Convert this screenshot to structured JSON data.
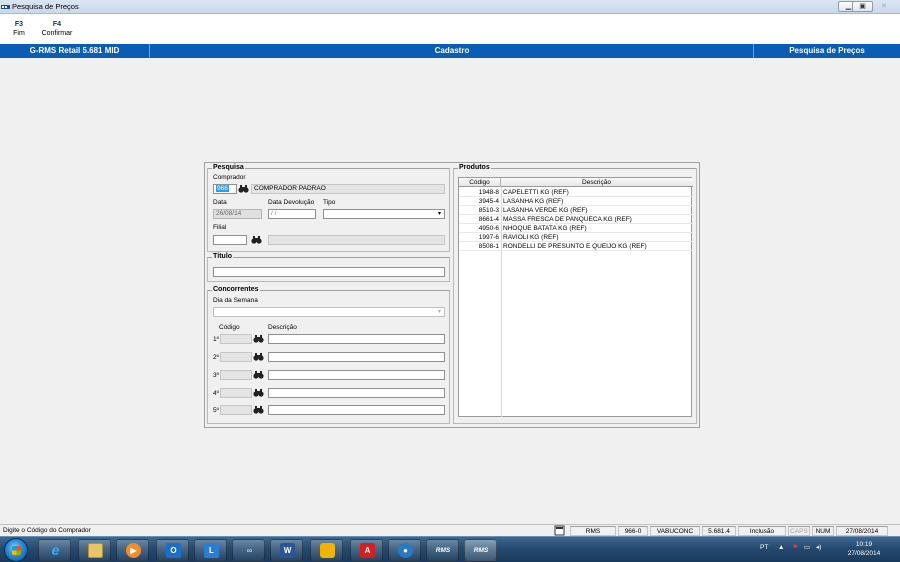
{
  "window": {
    "title": "Pesquisa de Preços"
  },
  "fkeys": [
    {
      "key": "F3",
      "label": "Fim"
    },
    {
      "key": "F4",
      "label": "Confirmar"
    }
  ],
  "header": {
    "version": "G-RMS Retail 5.681 MID",
    "section": "Cadastro",
    "screen": "Pesquisa de Preços"
  },
  "pesquisa": {
    "legend": "Pesquisa",
    "comprador_label": "Comprador",
    "comprador_code": "966",
    "comprador_name": "COMPRADOR PADRAO",
    "data_label": "Data",
    "data_value": "26/08/14",
    "devolucao_label": "Data Devolução",
    "devolucao_value": " / /",
    "tipo_label": "Tipo",
    "tipo_value": "",
    "filial_label": "Filial",
    "filial_value": "",
    "filial_name": ""
  },
  "titulo": {
    "legend": "Título",
    "value": ""
  },
  "concorrentes": {
    "legend": "Concorrentes",
    "dia_label": "Dia da Semana",
    "dia_value": "",
    "col_codigo": "Código",
    "col_descricao": "Descrição",
    "rows": [
      {
        "num": "1º",
        "codigo": "",
        "descricao": ""
      },
      {
        "num": "2º",
        "codigo": "",
        "descricao": ""
      },
      {
        "num": "3º",
        "codigo": "",
        "descricao": ""
      },
      {
        "num": "4º",
        "codigo": "",
        "descricao": ""
      },
      {
        "num": "5º",
        "codigo": "",
        "descricao": ""
      }
    ]
  },
  "produtos": {
    "legend": "Produtos",
    "col_codigo": "Código",
    "col_descricao": "Descrição",
    "rows": [
      {
        "codigo": "1948-8",
        "descricao": "CAPELETTI KG (REF)"
      },
      {
        "codigo": "3945-4",
        "descricao": "LASANHA KG (REF)"
      },
      {
        "codigo": "8510-3",
        "descricao": "LASANHA VERDE KG (REF)"
      },
      {
        "codigo": "8661-4",
        "descricao": "MASSA FRESCA DE PANQUECA KG (REF)"
      },
      {
        "codigo": "4950-6",
        "descricao": "NHOQUE BATATA KG (REF)"
      },
      {
        "codigo": "1997-6",
        "descricao": "RAVIOLI KG (REF)"
      },
      {
        "codigo": "8508-1",
        "descricao": "RONDELLI DE PRESUNTO E QUEIJO KG (REF)"
      }
    ]
  },
  "status": {
    "message": "Digite o Código do Comprador",
    "system": "RMS",
    "code": "966-0",
    "user": "VABUCONC",
    "version": "5.681.4",
    "mode": "Inclusão",
    "caps": "CAPS",
    "num": "NUM",
    "date": "27/08/2014"
  },
  "taskbar": {
    "apps": [
      "ie-icon",
      "explorer-icon",
      "media-player-icon",
      "outlook-icon",
      "lync-icon",
      "remote-icon",
      "word-icon",
      "stack-icon",
      "acrobat-icon",
      "network-icon",
      "rms-icon",
      "rms-icon"
    ],
    "rms_label": "RMS",
    "lang": "PT",
    "time": "10:19",
    "date": "27/08/2014"
  },
  "colors": {
    "header_blue": "#0a5db4",
    "fkey_blue": "#0b2b8a",
    "selection": "#3399ff"
  }
}
